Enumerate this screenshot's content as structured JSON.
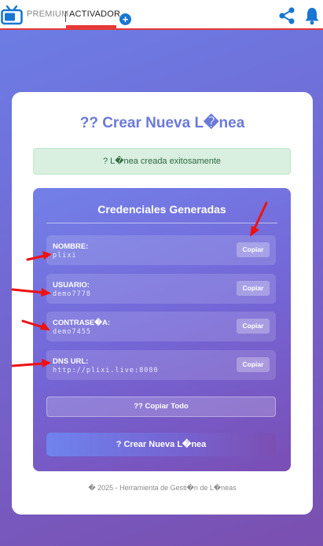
{
  "topbar": {
    "tabs": [
      {
        "label": "PREMIUM"
      },
      {
        "label": "ACTIVADOR"
      }
    ],
    "add_label": "+",
    "icons": {
      "logo": "tv-icon",
      "share": "share-icon",
      "notify": "bell-icon"
    },
    "accent_color": "#e53935",
    "icon_color": "#1976d2"
  },
  "card": {
    "title": "?? Crear Nueva L�nea",
    "alert": "? L�nea creada exitosamente",
    "panel": {
      "title": "Credenciales Generadas",
      "credentials": [
        {
          "label": "NOMBRE:",
          "value": "plixi",
          "copy": "Copiar"
        },
        {
          "label": "USUARIO:",
          "value": "demo7778",
          "copy": "Copiar"
        },
        {
          "label": "CONTRASE�A:",
          "value": "demo7455",
          "copy": "Copiar"
        },
        {
          "label": "DNS URL:",
          "value": "http://plixi.live:8080",
          "copy": "Copiar"
        }
      ],
      "copy_all": "?? Copiar Todo",
      "create_new": "? Crear Nueva L�nea"
    },
    "footer": "� 2025 - Herramienta de Gesti�n de L�neas"
  },
  "annotation_color": "#ee1111"
}
